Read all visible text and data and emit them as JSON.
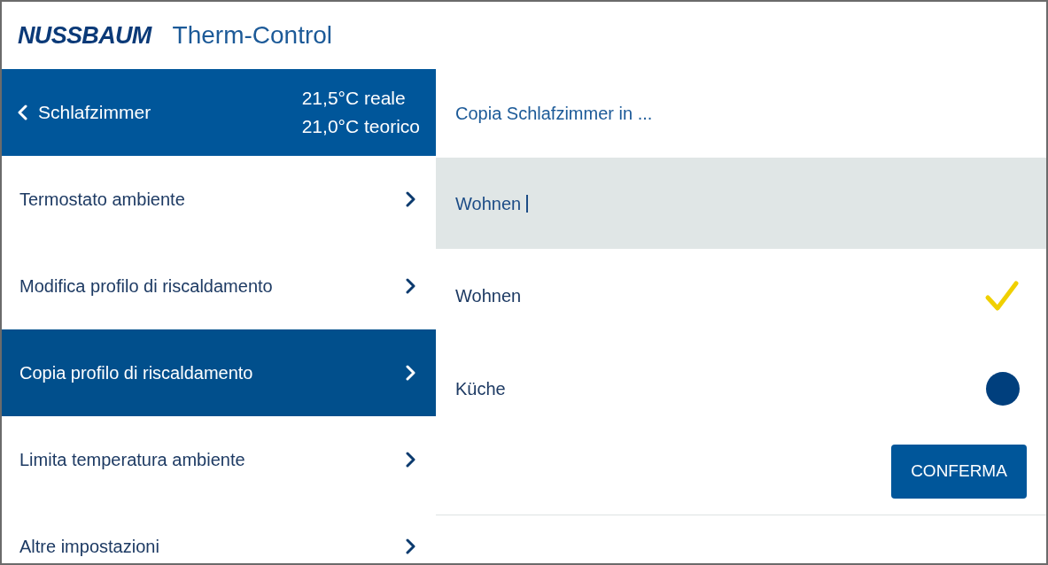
{
  "header": {
    "logo": "NUSSBAUM",
    "title": "Therm-Control"
  },
  "room": {
    "back_label": "Schlafzimmer",
    "actual": "21,5°C reale",
    "target": "21,0°C teorico"
  },
  "menu": [
    {
      "label": "Termostato ambiente",
      "selected": false
    },
    {
      "label": "Modifica profilo di riscaldamento",
      "selected": false
    },
    {
      "label": "Copia profilo di riscaldamento",
      "selected": true
    },
    {
      "label": "Limita temperatura ambiente",
      "selected": false
    },
    {
      "label": "Altre impostazioni",
      "selected": false
    }
  ],
  "copy_panel": {
    "title": "Copia Schlafzimmer in ...",
    "filter": {
      "value": "Wohnen"
    },
    "rooms": [
      {
        "label": "Wohnen",
        "selected": true
      },
      {
        "label": "Küche",
        "selected": false
      }
    ],
    "confirm_button": "CONFERMA"
  }
}
